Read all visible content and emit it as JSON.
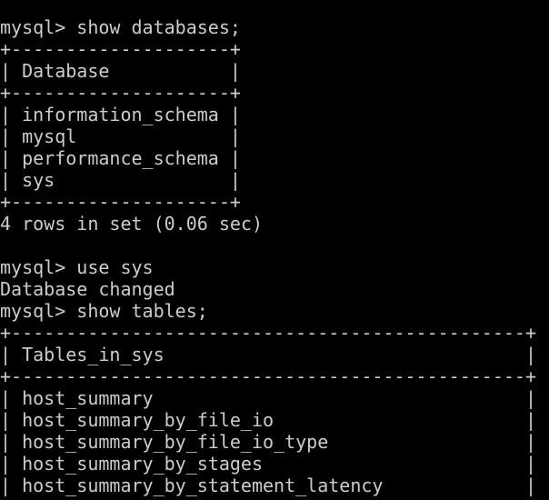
{
  "terminal": {
    "colors": {
      "background": "#000000",
      "foreground": "#cccccc"
    },
    "lines": [
      "mysql> show databases;",
      "+--------------------+",
      "| Database           |",
      "+--------------------+",
      "| information_schema |",
      "| mysql              |",
      "| performance_schema |",
      "| sys                |",
      "+--------------------+",
      "4 rows in set (0.06 sec)",
      "",
      "mysql> use sys",
      "Database changed",
      "mysql> show tables;",
      "+-----------------------------------------------+",
      "| Tables_in_sys                                 |",
      "+-----------------------------------------------+",
      "| host_summary                                  |",
      "| host_summary_by_file_io                       |",
      "| host_summary_by_file_io_type                  |",
      "| host_summary_by_stages                        |",
      "| host_summary_by_statement_latency             |"
    ]
  }
}
